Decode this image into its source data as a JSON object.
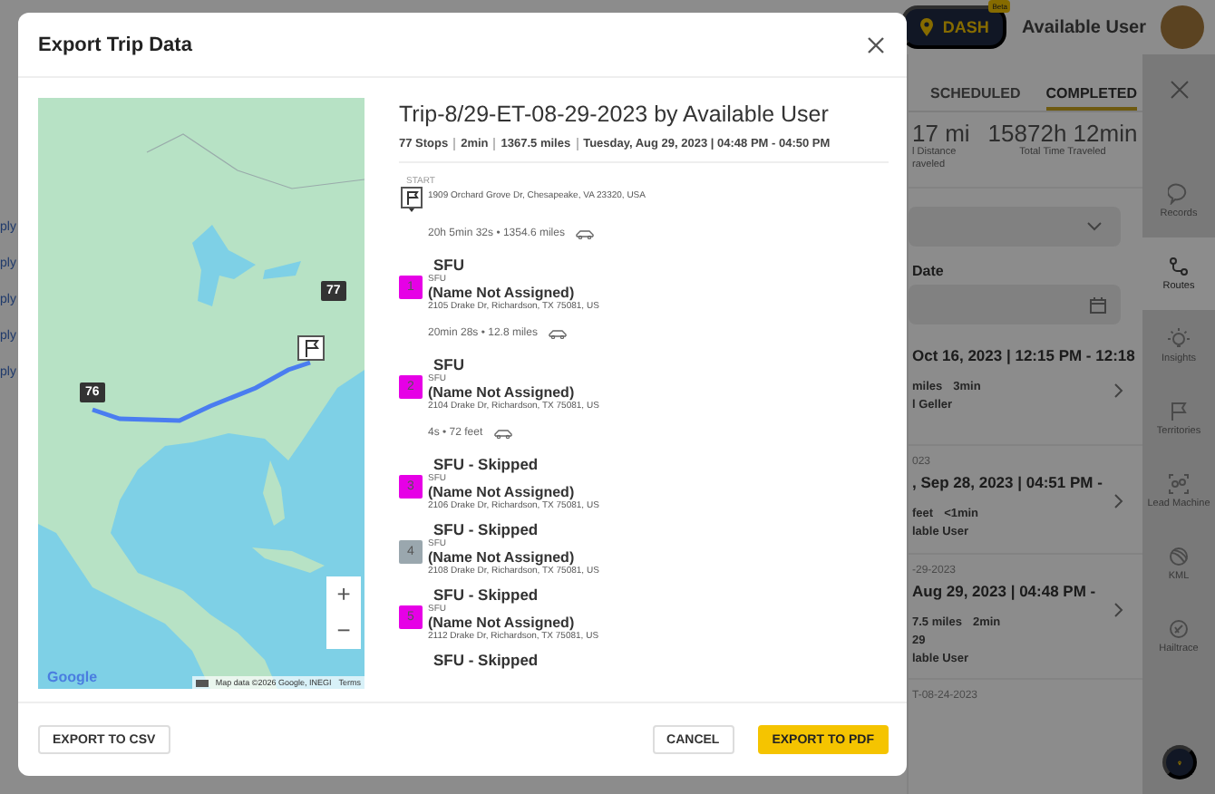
{
  "top_bar": {
    "dash_badge": "DASH",
    "beta_tag": "Beta",
    "user_name": "Available User"
  },
  "left_fragments": [
    "ply",
    "ply",
    "ply",
    "ply",
    "ply"
  ],
  "panel": {
    "tabs": [
      {
        "label": "SCHEDULED",
        "selected": false
      },
      {
        "label": "COMPLETED",
        "selected": true
      }
    ],
    "stats": [
      {
        "value": "17 mi",
        "label_lines": [
          "l Distance",
          "raveled"
        ]
      },
      {
        "value": "15872h 12min",
        "label_lines": [
          "Total Time Traveled"
        ]
      }
    ],
    "date_label": "Date",
    "trips": [
      {
        "when": "Oct 16, 2023 | 12:15 PM - 12:18",
        "details": [
          "miles",
          "3min"
        ],
        "person": "l Geller"
      },
      {
        "title": "023",
        "when": ", Sep 28, 2023 | 04:51 PM -",
        "details": [
          "feet",
          "<1min"
        ],
        "person": "lable User"
      },
      {
        "title": "-29-2023",
        "when": "Aug 29, 2023 | 04:48 PM -",
        "details": [
          "7.5 miles",
          "2min"
        ],
        "note": "29",
        "person": "lable User"
      },
      {
        "title": "T-08-24-2023"
      }
    ]
  },
  "rail": {
    "items": [
      {
        "label": "Records",
        "selected": false
      },
      {
        "label": "Routes",
        "selected": true
      },
      {
        "label": "Insights",
        "selected": false
      },
      {
        "label": "Territories",
        "selected": false
      },
      {
        "label": "Lead Machine",
        "selected": false
      },
      {
        "label": "KML",
        "selected": false
      },
      {
        "label": "Hailtrace",
        "selected": false
      }
    ]
  },
  "modal": {
    "title": "Export Trip Data",
    "map": {
      "markers": [
        "77",
        "76"
      ],
      "zoom_in": "+",
      "zoom_out": "−",
      "logo": "Google",
      "attribution": "Map data ©2026 Google, INEGI",
      "terms": "Terms"
    },
    "trip": {
      "title": "Trip-8/29-ET-08-29-2023 by Available User",
      "meta": [
        "77 Stops",
        "2min",
        "1367.5 miles",
        "Tuesday, Aug 29, 2023 | 04:48 PM - 04:50 PM"
      ],
      "timeline": [
        {
          "kind": "start",
          "label": "START",
          "address": "1909 Orchard Grove Dr, Chesapeake, VA 23320, USA"
        },
        {
          "kind": "leg",
          "text": "20h 5min 32s • 1354.6 miles"
        },
        {
          "kind": "stop",
          "heading": "SFU",
          "number": "1",
          "color": "#e600e6",
          "category": "SFU",
          "name": "(Name Not Assigned)",
          "address": "2105 Drake Dr, Richardson, TX 75081, US"
        },
        {
          "kind": "leg",
          "text": "20min 28s • 12.8 miles"
        },
        {
          "kind": "stop",
          "heading": "SFU",
          "number": "2",
          "color": "#e600e6",
          "category": "SFU",
          "name": "(Name Not Assigned)",
          "address": "2104 Drake Dr, Richardson, TX 75081, US"
        },
        {
          "kind": "leg",
          "text": "4s • 72 feet"
        },
        {
          "kind": "stop",
          "heading": "SFU - Skipped",
          "number": "3",
          "color": "#e600e6",
          "category": "SFU",
          "name": "(Name Not Assigned)",
          "address": "2106 Drake Dr, Richardson, TX 75081, US"
        },
        {
          "kind": "stop",
          "heading": "SFU - Skipped",
          "number": "4",
          "color": "#9aa7ae",
          "category": "SFU",
          "name": "(Name Not Assigned)",
          "address": "2108 Drake Dr, Richardson, TX 75081, US"
        },
        {
          "kind": "stop",
          "heading": "SFU - Skipped",
          "number": "5",
          "color": "#e600e6",
          "category": "SFU",
          "name": "(Name Not Assigned)",
          "address": "2112 Drake Dr, Richardson, TX 75081, US"
        },
        {
          "kind": "stop",
          "heading": "SFU - Skipped"
        }
      ]
    },
    "footer": {
      "left_buttons": [
        {
          "label": "EXPORT TO CSV",
          "kind": "outline"
        }
      ],
      "right_buttons": [
        {
          "label": "CANCEL",
          "kind": "outline"
        },
        {
          "label": "EXPORT TO PDF",
          "kind": "primary"
        }
      ]
    }
  }
}
